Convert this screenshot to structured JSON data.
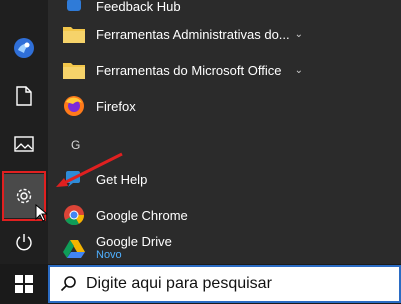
{
  "colors": {
    "highlight": "#e02020",
    "folder": "#f2c64a",
    "accent_link": "#4fb0ff"
  },
  "rail": {
    "items": [
      {
        "name": "avatar",
        "icon": "user-avatar"
      },
      {
        "name": "documents",
        "icon": "document-icon"
      },
      {
        "name": "pictures",
        "icon": "pictures-icon"
      },
      {
        "name": "settings",
        "icon": "gear-icon",
        "highlighted": true
      },
      {
        "name": "power",
        "icon": "power-icon"
      }
    ]
  },
  "apps": {
    "top_partial": "Feedback Hub",
    "folder1": "Ferramentas Administrativas do...",
    "folder2": "Ferramentas do Microsoft Office",
    "firefox": "Firefox",
    "letter_g": "G",
    "gethelp": "Get Help",
    "chrome": "Google Chrome",
    "drive": "Google Drive",
    "drive_badge": "Novo"
  },
  "search": {
    "placeholder": "Digite aqui para pesquisar"
  }
}
